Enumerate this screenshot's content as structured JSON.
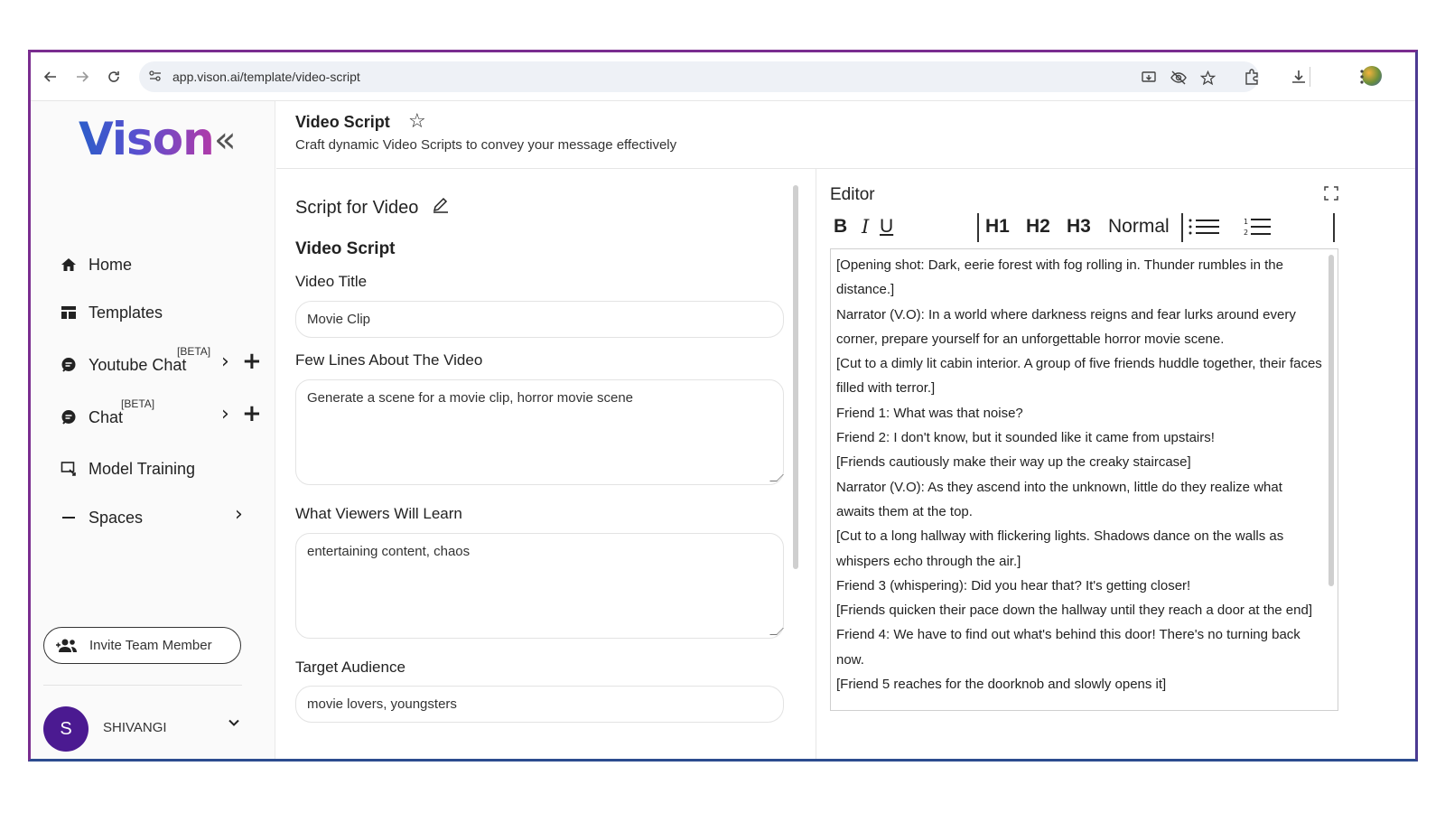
{
  "browser": {
    "url": "app.vison.ai/template/video-script"
  },
  "sidebar": {
    "logo_text": "Vison",
    "items": [
      {
        "label": "Home",
        "icon": "home-icon"
      },
      {
        "label": "Templates",
        "icon": "templates-icon"
      },
      {
        "label": "Youtube Chat",
        "icon": "chat-icon",
        "badge": "[BETA]"
      },
      {
        "label": "Chat",
        "icon": "chat-icon",
        "badge": "[BETA]"
      },
      {
        "label": "Model Training",
        "icon": "model-training-icon"
      },
      {
        "label": "Spaces",
        "icon": "minus-icon"
      }
    ],
    "invite_label": "Invite Team Member",
    "user": {
      "initial": "S",
      "name": "SHIVANGI"
    }
  },
  "header": {
    "title": "Video Script",
    "subtitle": "Craft dynamic Video Scripts to convey your message effectively"
  },
  "form": {
    "title": "Script for Video",
    "section": "Video Script",
    "fields": [
      {
        "label": "Video Title",
        "value": "Movie Clip"
      },
      {
        "label": "Few Lines About The Video",
        "value": "Generate a scene for a movie clip, horror movie scene"
      },
      {
        "label": "What Viewers Will Learn",
        "value": "entertaining content, chaos"
      },
      {
        "label": "Target Audience",
        "value": "movie lovers, youngsters"
      }
    ]
  },
  "editor": {
    "title": "Editor",
    "toolbar": {
      "bold": "B",
      "italic": "I",
      "underline": "U",
      "h1": "H1",
      "h2": "H2",
      "h3": "H3",
      "normal": "Normal"
    },
    "lines": [
      "[Opening shot: Dark, eerie forest with fog rolling in. Thunder rumbles in the distance.]",
      "Narrator (V.O): In a world where darkness reigns and fear lurks around every corner, prepare yourself for an unforgettable horror movie scene.",
      "[Cut to a dimly lit cabin interior. A group of five friends huddle together, their faces filled with terror.]",
      "Friend 1: What was that noise?",
      "Friend 2: I don't know, but it sounded like it came from upstairs!",
      "[Friends cautiously make their way up the creaky staircase]",
      "Narrator (V.O): As they ascend into the unknown, little do they realize what awaits them at the top.",
      "[Cut to a long hallway with flickering lights. Shadows dance on the walls as whispers echo through the air.]",
      "Friend 3 (whispering): Did you hear that? It's getting closer!",
      "[Friends quicken their pace down the hallway until they reach a door at the end]",
      "Friend 4: We have to find out what's behind this door! There's no turning back now.",
      "[Friend 5 reaches for the doorknob and slowly opens it]"
    ]
  },
  "colors": {
    "frame": "#7a2d8f",
    "avatar": "#4b1a91",
    "logo_start": "#2c5dc9",
    "logo_end": "#b23aa8"
  }
}
